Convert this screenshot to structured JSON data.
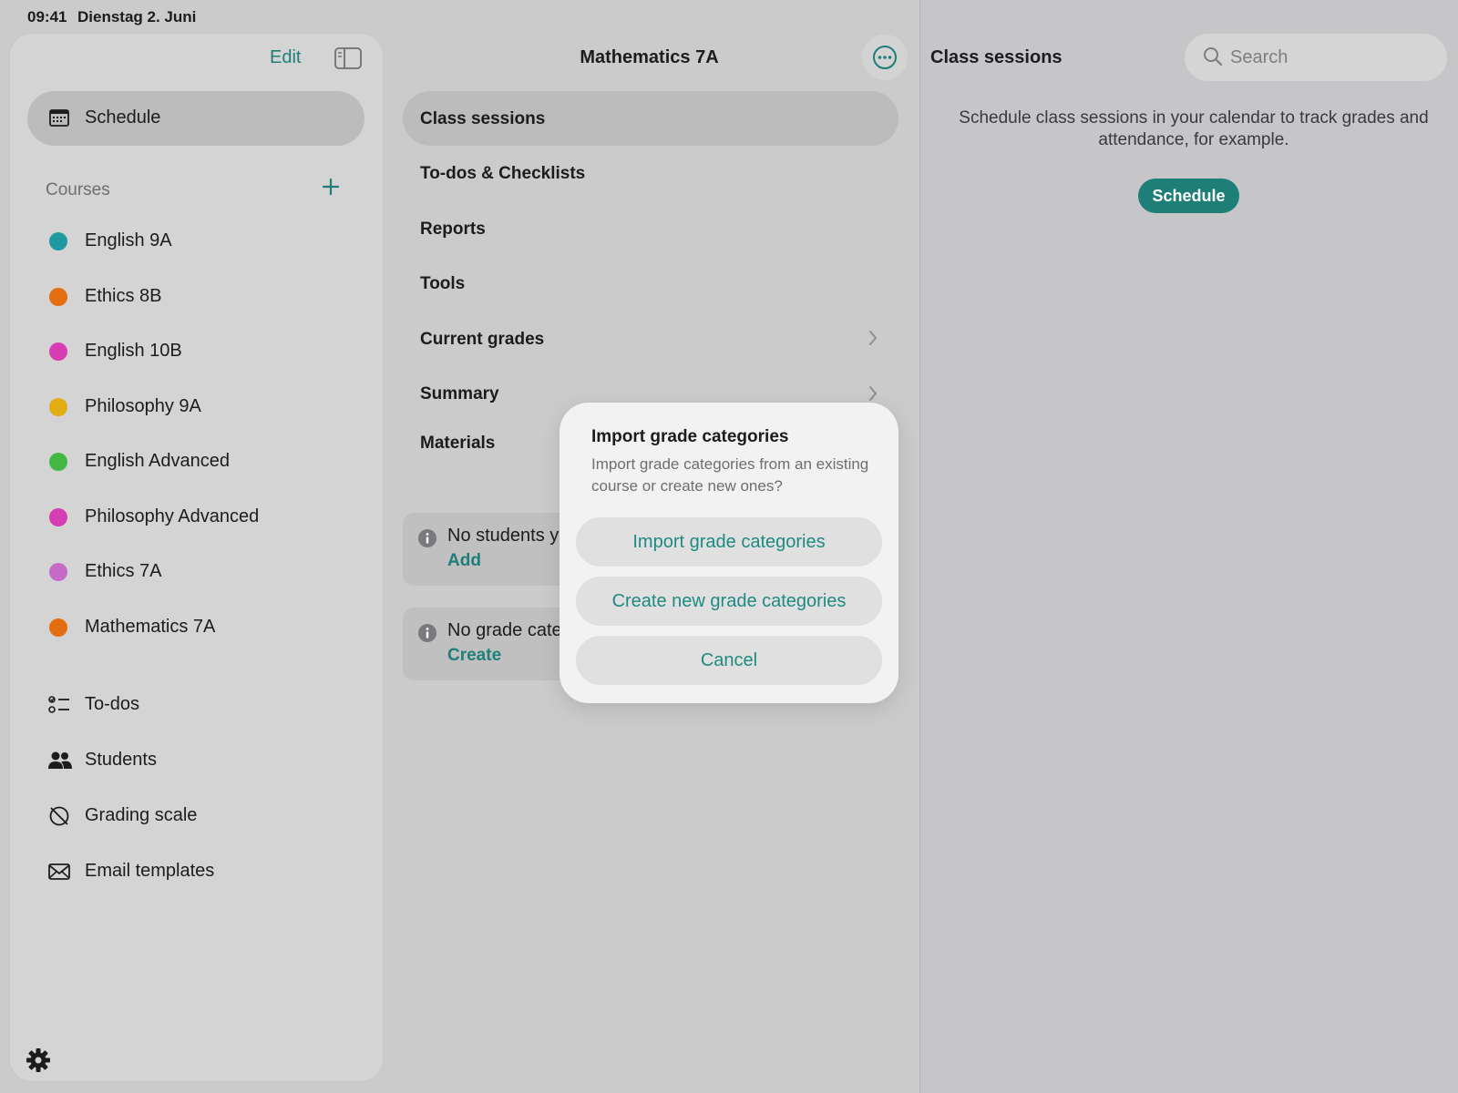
{
  "status_bar": {
    "time": "09:41",
    "date": "Dienstag 2. Juni"
  },
  "sidebar": {
    "edit_label": "Edit",
    "schedule_label": "Schedule",
    "courses_heading": "Courses",
    "courses": [
      {
        "label": "English 9A",
        "color": "#1f9aa0"
      },
      {
        "label": "Ethics 8B",
        "color": "#e46d10"
      },
      {
        "label": "English 10B",
        "color": "#d63db3"
      },
      {
        "label": "Philosophy 9A",
        "color": "#e0ad12"
      },
      {
        "label": "English Advanced",
        "color": "#43b944"
      },
      {
        "label": "Philosophy Advanced",
        "color": "#d63db3"
      },
      {
        "label": "Ethics 7A",
        "color": "#c66bc8"
      },
      {
        "label": "Mathematics 7A",
        "color": "#e46d10"
      }
    ],
    "nav": [
      {
        "label": "To-dos",
        "icon": "checklist-icon"
      },
      {
        "label": "Students",
        "icon": "people-icon"
      },
      {
        "label": "Grading scale",
        "icon": "grading-scale-icon"
      },
      {
        "label": "Email templates",
        "icon": "envelope-icon"
      }
    ]
  },
  "middle": {
    "title": "Mathematics 7A",
    "menu": [
      "Class sessions",
      "To-dos & Checklists",
      "Reports",
      "Tools",
      "Current grades",
      "Summary",
      "Materials"
    ],
    "info_cards": [
      {
        "text": "No students y",
        "action": "Add"
      },
      {
        "text": "No grade cate",
        "action": "Create"
      }
    ]
  },
  "right": {
    "title": "Class sessions",
    "search_placeholder": "Search",
    "message": "Schedule class sessions in your calendar to track grades and attendance, for example.",
    "schedule_button": "Schedule"
  },
  "dialog": {
    "title": "Import grade categories",
    "message": "Import grade categories from an existing course or create new ones?",
    "buttons": [
      "Import grade categories",
      "Create new grade categories",
      "Cancel"
    ]
  },
  "colors": {
    "accent": "#1e7f78",
    "background": "#cbcbcb"
  }
}
